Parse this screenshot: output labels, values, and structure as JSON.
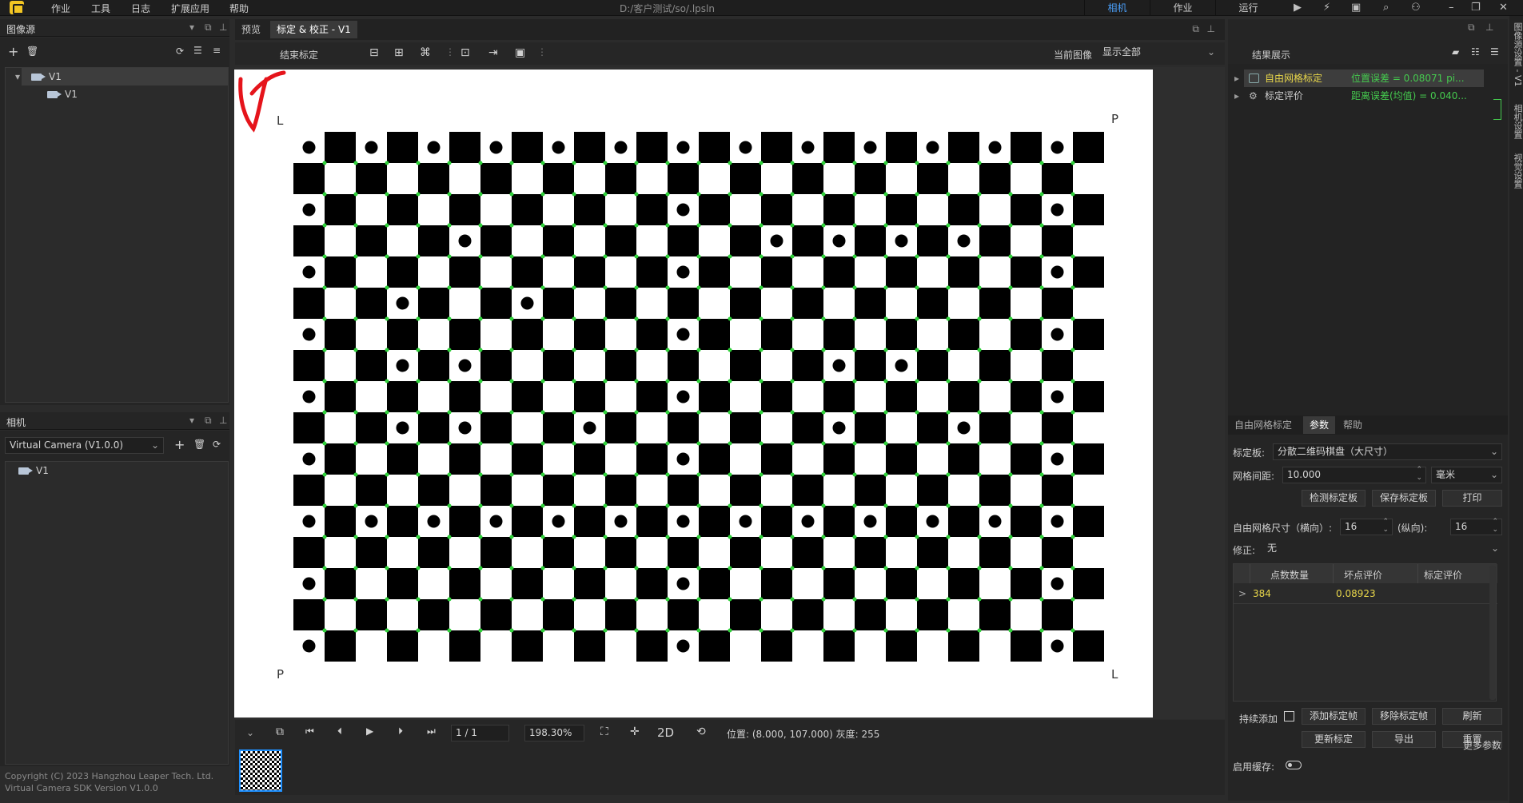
{
  "menubar": {
    "items": [
      "作业",
      "工具",
      "日志",
      "扩展应用",
      "帮助"
    ],
    "path": "D:/客户测试/so/.lpsln",
    "buttons": [
      "相机",
      "作业",
      "运行"
    ]
  },
  "left": {
    "image_source_title": "图像源",
    "tree_root": "V1",
    "tree_child": "V1",
    "camera_title": "相机",
    "camera_select": "Virtual Camera (V1.0.0)",
    "camera_item": "V1",
    "copyright": "Copyright (C) 2023 Hangzhou Leaper Tech. Ltd.",
    "sdk": "Virtual Camera SDK Version V1.0.0"
  },
  "center": {
    "tabs": [
      "预览",
      "标定 & 校正 - V1"
    ],
    "end_calib": "结束标定",
    "current_image_label": "当前图像",
    "current_image_value": "显示全部",
    "label_L1": "L",
    "label_P1": "P",
    "label_P2": "P",
    "label_L2": "L",
    "frame": "1 / 1",
    "zoom": "198.30%",
    "mode2d": "2D",
    "status": "位置: (8.000, 107.000)  灰度: 255"
  },
  "right": {
    "result_title": "结果展示",
    "results": [
      {
        "name": "自由网格标定",
        "value": "位置误差 = 0.08071 pi..."
      },
      {
        "name": "标定评价",
        "value": "距离误差(均值) = 0.040..."
      }
    ],
    "tabs": [
      "自由网格标定",
      "参数",
      "帮助"
    ],
    "board_label": "标定板:",
    "board_value": "分散二维码棋盘（大尺寸）",
    "spacing_label": "网格间距:",
    "spacing_value": "10.000",
    "unit": "毫米",
    "detect_btn": "检测标定板",
    "save_btn": "保存标定板",
    "print_btn": "打印",
    "grid_label": "自由网格尺寸（横向）:",
    "grid_h": "16",
    "grid_v_label": "(纵向):",
    "grid_v": "16",
    "correct_label": "修正:",
    "correct_value": "无",
    "table_headers": [
      "点数数量",
      "坏点评价",
      "标定评价"
    ],
    "table_row": [
      ">",
      "384",
      "0.08923",
      ""
    ],
    "continuous_label": "持续添加",
    "add_btn": "添加标定帧",
    "remove_btn": "移除标定帧",
    "refresh_btn": "刷新",
    "update_btn": "更新标定",
    "export_btn": "导出",
    "reset_btn": "重置",
    "more": "更多参数",
    "cache_label": "启用缓存:"
  },
  "sidebar_vertical": [
    "图像源设置 - V1",
    "相机设置",
    "视觉设置"
  ],
  "chess": {
    "cols": 26,
    "rows": 17,
    "pattern_cell": 39,
    "dots": [
      [
        0,
        0
      ],
      [
        2,
        0
      ],
      [
        4,
        0
      ],
      [
        6,
        0
      ],
      [
        8,
        0
      ],
      [
        10,
        0
      ],
      [
        12,
        0
      ],
      [
        14,
        0
      ],
      [
        16,
        0
      ],
      [
        18,
        0
      ],
      [
        20,
        0
      ],
      [
        22,
        0
      ],
      [
        24,
        0
      ],
      [
        0,
        2
      ],
      [
        12,
        2
      ],
      [
        24,
        2
      ],
      [
        5,
        3
      ],
      [
        15,
        3
      ],
      [
        17,
        3
      ],
      [
        19,
        3
      ],
      [
        21,
        3
      ],
      [
        0,
        4
      ],
      [
        12,
        4
      ],
      [
        24,
        4
      ],
      [
        3,
        5
      ],
      [
        7,
        5
      ],
      [
        0,
        6
      ],
      [
        12,
        6
      ],
      [
        24,
        6
      ],
      [
        3,
        7
      ],
      [
        5,
        7
      ],
      [
        17,
        7
      ],
      [
        19,
        7
      ],
      [
        0,
        8
      ],
      [
        12,
        8
      ],
      [
        24,
        8
      ],
      [
        3,
        9
      ],
      [
        5,
        9
      ],
      [
        9,
        9
      ],
      [
        17,
        9
      ],
      [
        21,
        9
      ],
      [
        0,
        10
      ],
      [
        12,
        10
      ],
      [
        24,
        10
      ],
      [
        0,
        12
      ],
      [
        2,
        12
      ],
      [
        4,
        12
      ],
      [
        6,
        12
      ],
      [
        8,
        12
      ],
      [
        10,
        12
      ],
      [
        12,
        12
      ],
      [
        14,
        12
      ],
      [
        16,
        12
      ],
      [
        18,
        12
      ],
      [
        20,
        12
      ],
      [
        22,
        12
      ],
      [
        24,
        12
      ],
      [
        0,
        14
      ],
      [
        12,
        14
      ],
      [
        24,
        14
      ],
      [
        0,
        16
      ],
      [
        12,
        16
      ],
      [
        24,
        16
      ]
    ]
  }
}
